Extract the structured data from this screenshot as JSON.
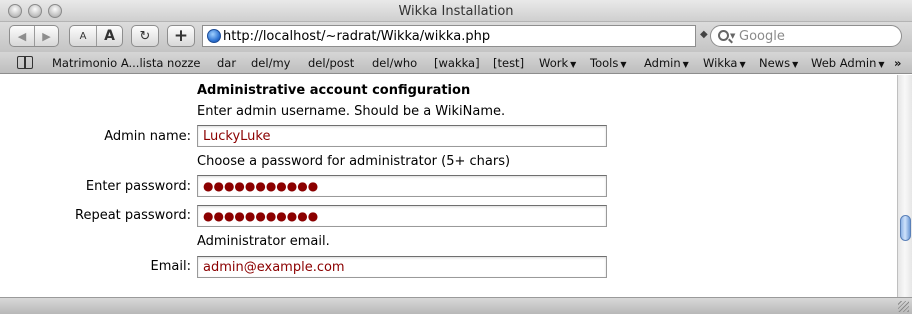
{
  "window": {
    "title": "Wikka Installation"
  },
  "toolbar": {
    "back_glyph": "◀",
    "forward_glyph": "▶",
    "text_smaller": "A",
    "text_bigger": "A",
    "reload_glyph": "↻",
    "add_glyph": "+",
    "url": "http://localhost/~radrat/Wikka/wikka.php",
    "search_placeholder": "Google"
  },
  "bookmarks": [
    {
      "label": "Matrimonio A...lista nozze",
      "menu": false
    },
    {
      "label": "dar",
      "menu": false
    },
    {
      "label": "del/my",
      "menu": false
    },
    {
      "label": "del/post",
      "menu": false
    },
    {
      "label": "del/who",
      "menu": false
    },
    {
      "label": "[wakka]",
      "menu": false
    },
    {
      "label": "[test]",
      "menu": false
    },
    {
      "label": "Work",
      "menu": true
    },
    {
      "label": "Tools",
      "menu": true
    },
    {
      "label": "Admin",
      "menu": true
    },
    {
      "label": "Wikka",
      "menu": true
    },
    {
      "label": "News",
      "menu": true
    },
    {
      "label": "Web Admin",
      "menu": true
    }
  ],
  "bookmarks_overflow": "»",
  "form": {
    "heading": "Administrative account configuration",
    "username_hint": "Enter admin username. Should be a WikiName.",
    "admin_name_label": "Admin name:",
    "admin_name_value": "LuckyLuke",
    "password_hint": "Choose a password for administrator (5+ chars)",
    "enter_password_label": "Enter password:",
    "enter_password_value": "●●●●●●●●●●●",
    "repeat_password_label": "Repeat password:",
    "repeat_password_value": "●●●●●●●●●●●",
    "email_hint": "Administrator email.",
    "email_label": "Email:",
    "email_value": "admin@example.com"
  },
  "icons": {
    "bookmarks": "book-icon",
    "url": "globe-icon",
    "search": "search-icon"
  },
  "colors": {
    "field_text": "#8b0000",
    "scroll_thumb": "#8fb4e6"
  }
}
